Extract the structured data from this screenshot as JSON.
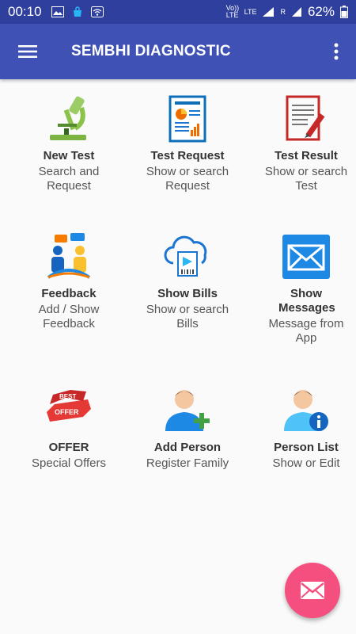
{
  "status_bar": {
    "time": "00:10",
    "volte_label": "Vo)) LTE",
    "lte_label": "LTE",
    "roaming_label": "R",
    "battery": "62%"
  },
  "app_bar": {
    "title": "SEMBHI DIAGNOSTIC"
  },
  "tiles": [
    {
      "title": "New Test",
      "subtitle": "Search and Request",
      "icon": "microscope-icon"
    },
    {
      "title": "Test Request",
      "subtitle": "Show or search Request",
      "icon": "report-chart-icon"
    },
    {
      "title": "Test Result",
      "subtitle": "Show or search Test",
      "icon": "document-pen-icon"
    },
    {
      "title": "Feedback",
      "subtitle": "Add / Show Feedback",
      "icon": "people-chat-icon"
    },
    {
      "title": "Show Bills",
      "subtitle": "Show or search Bills",
      "icon": "cloud-receipt-icon"
    },
    {
      "title": "Show Messages",
      "subtitle": "Message from App",
      "icon": "envelope-icon"
    },
    {
      "title": "OFFER",
      "subtitle": "Special Offers",
      "icon": "best-offer-ribbon-icon",
      "ribbon_text_1": "BEST",
      "ribbon_text_2": "OFFER"
    },
    {
      "title": "Add Person",
      "subtitle": "Register Family",
      "icon": "person-add-icon"
    },
    {
      "title": "Person List",
      "subtitle": "Show or Edit",
      "icon": "person-info-icon"
    }
  ],
  "colors": {
    "status_bar": "#2f3f9e",
    "app_bar": "#3f51b5",
    "fab": "#f44f7f"
  }
}
